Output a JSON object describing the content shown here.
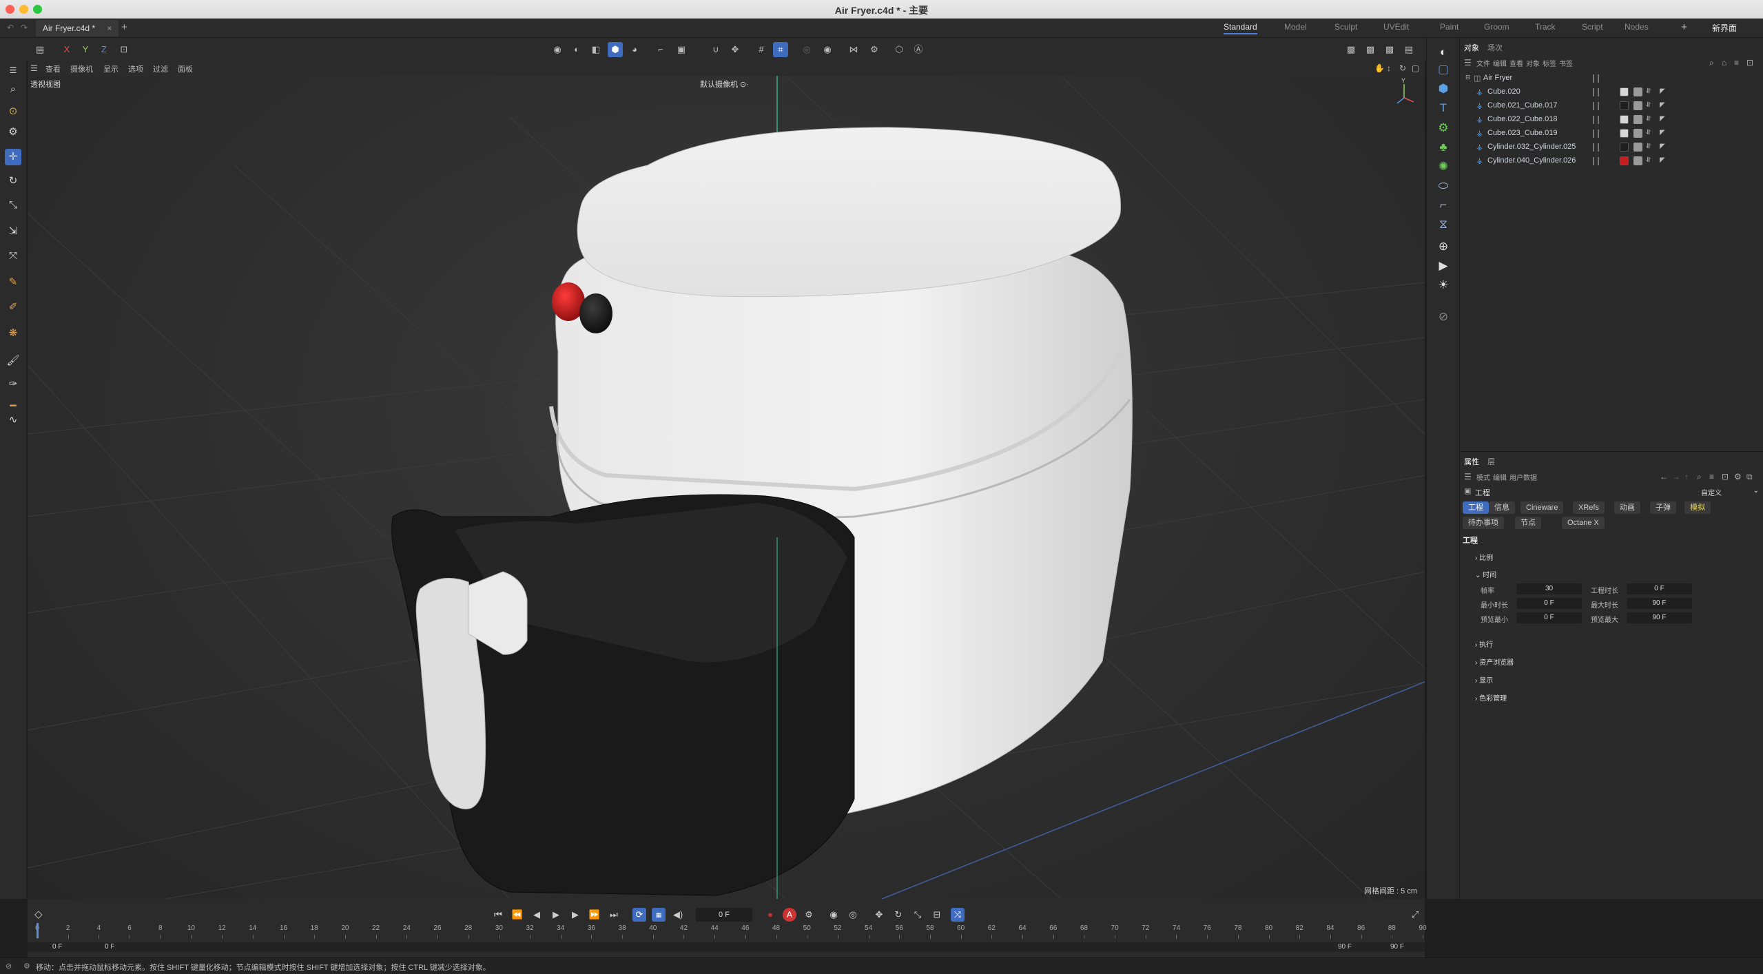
{
  "window": {
    "title": "Air Fryer.c4d * - 主要"
  },
  "document_tab": {
    "label": "Air Fryer.c4d *",
    "close": "×",
    "add": "+"
  },
  "layouts": [
    "Standard",
    "Model",
    "Sculpt",
    "UVEdit",
    "Paint",
    "Groom",
    "Track",
    "Script",
    "Nodes"
  ],
  "layouts_active": "Standard",
  "new_layout": "新界面",
  "axis_buttons": [
    "X",
    "Y",
    "Z"
  ],
  "viewport_menu": [
    "查看",
    "摄像机",
    "显示",
    "选项",
    "过滤",
    "面板"
  ],
  "viewport": {
    "label": "透视视图",
    "camera": "默认摄像机 ⊙·",
    "grid_spacing": "网格间距 : 5 cm",
    "axis_y": "Y"
  },
  "object_manager": {
    "tabs": [
      "对象",
      "场次"
    ],
    "menu": [
      "文件",
      "编辑",
      "查看",
      "对象",
      "标签",
      "书签"
    ],
    "root": "Air Fryer",
    "objects": [
      {
        "name": "Cube.020",
        "mat": "#d6d6d6"
      },
      {
        "name": "Cube.021_Cube.017",
        "mat": "#1e1e1e"
      },
      {
        "name": "Cube.022_Cube.018",
        "mat": "#d6d6d6"
      },
      {
        "name": "Cube.023_Cube.019",
        "mat": "#d6d6d6"
      },
      {
        "name": "Cylinder.032_Cylinder.025",
        "mat": "#1e1e1e"
      },
      {
        "name": "Cylinder.040_Cylinder.026",
        "mat": "#c81d1d"
      }
    ]
  },
  "attributes": {
    "tabs": [
      "属性",
      "层"
    ],
    "menu": [
      "模式",
      "编辑",
      "用户数据"
    ],
    "header": "工程",
    "preset": "自定义",
    "buttons_row1": [
      "工程",
      "信息",
      "Cineware",
      "XRefs",
      "动画",
      "子弹",
      "模拟"
    ],
    "buttons_row2": [
      "待办事项",
      "节点",
      "Octane X"
    ],
    "section": "工程",
    "groups": [
      "比例",
      "时间",
      "执行",
      "资产浏览器",
      "显示",
      "色彩管理"
    ],
    "fields": {
      "fps_label": "帧率",
      "fps": "30",
      "doc_time_label": "工程时长",
      "doc_time": "0 F",
      "min_time_label": "最小时长",
      "min_time": "0 F",
      "max_time_label": "最大时长",
      "max_time": "90 F",
      "prev_min_label": "预览最小",
      "prev_min": "0 F",
      "prev_max_label": "预览最大",
      "prev_max": "90 F"
    }
  },
  "timeline": {
    "current_frame": "0 F",
    "ticks": [
      0,
      2,
      4,
      6,
      8,
      10,
      12,
      14,
      16,
      18,
      20,
      22,
      24,
      26,
      28,
      30,
      32,
      34,
      36,
      38,
      40,
      42,
      44,
      46,
      48,
      50,
      52,
      54,
      56,
      58,
      60,
      62,
      64,
      66,
      68,
      70,
      72,
      74,
      76,
      78,
      80,
      82,
      84,
      86,
      88,
      90
    ],
    "start": "0 F",
    "start2": "0 F",
    "end": "90 F",
    "end2": "90 F"
  },
  "status": "移动：点击并拖动鼠标移动元素。按住 SHIFT 键量化移动；节点编辑模式时按住 SHIFT 键增加选择对象；按住 CTRL 键减少选择对象。",
  "colors": {
    "accent": "#3f6cbf",
    "close": "#ff5f57",
    "minimize": "#febc2e",
    "zoom": "#28c840",
    "button_red": "#c81d1d"
  }
}
